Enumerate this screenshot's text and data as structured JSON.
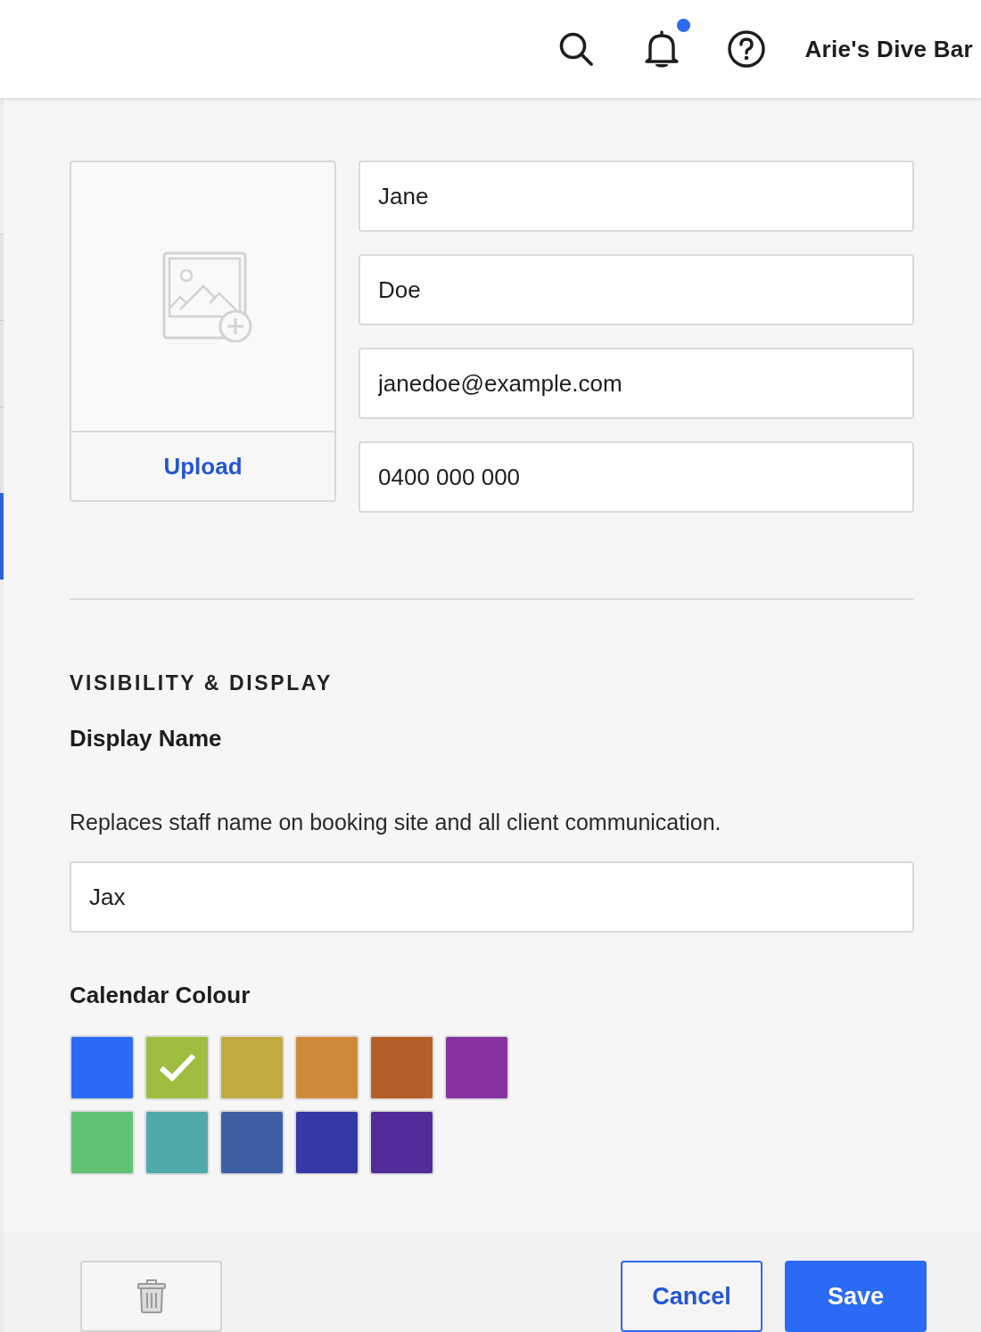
{
  "header": {
    "account_name": "Arie's Dive Bar",
    "notification_badge": true
  },
  "sidebar": {
    "items": [
      {
        "selected": false
      },
      {
        "selected": false
      },
      {
        "selected": false
      },
      {
        "selected": true
      }
    ]
  },
  "profile": {
    "photo": {
      "upload_label": "Upload"
    },
    "fields": [
      {
        "value": "Jane"
      },
      {
        "value": "Doe"
      },
      {
        "value": "janedoe@example.com"
      },
      {
        "value": "0400 000 000"
      }
    ]
  },
  "visibility": {
    "heading": "VISIBILITY & DISPLAY",
    "display_name": {
      "label": "Display Name",
      "description": "Replaces staff name on booking site and all client communication.",
      "value": "Jax"
    },
    "calendar_colour": {
      "label": "Calendar Colour",
      "swatches": [
        {
          "color": "#2b6af5",
          "selected": false
        },
        {
          "color": "#9fbe40",
          "selected": true
        },
        {
          "color": "#c1ab40",
          "selected": false
        },
        {
          "color": "#cf893a",
          "selected": false
        },
        {
          "color": "#b5602a",
          "selected": false
        },
        {
          "color": "#8633a0",
          "selected": false
        },
        {
          "color": "#62c274",
          "selected": false
        },
        {
          "color": "#50a9a9",
          "selected": false
        },
        {
          "color": "#3f5ea5",
          "selected": false
        },
        {
          "color": "#3538a5",
          "selected": false
        },
        {
          "color": "#532c9a",
          "selected": false
        }
      ]
    }
  },
  "footer": {
    "buttons": [
      {
        "kind": "delete"
      },
      {
        "kind": "secondary",
        "label": "Cancel"
      },
      {
        "kind": "primary",
        "label": "Save"
      }
    ]
  }
}
